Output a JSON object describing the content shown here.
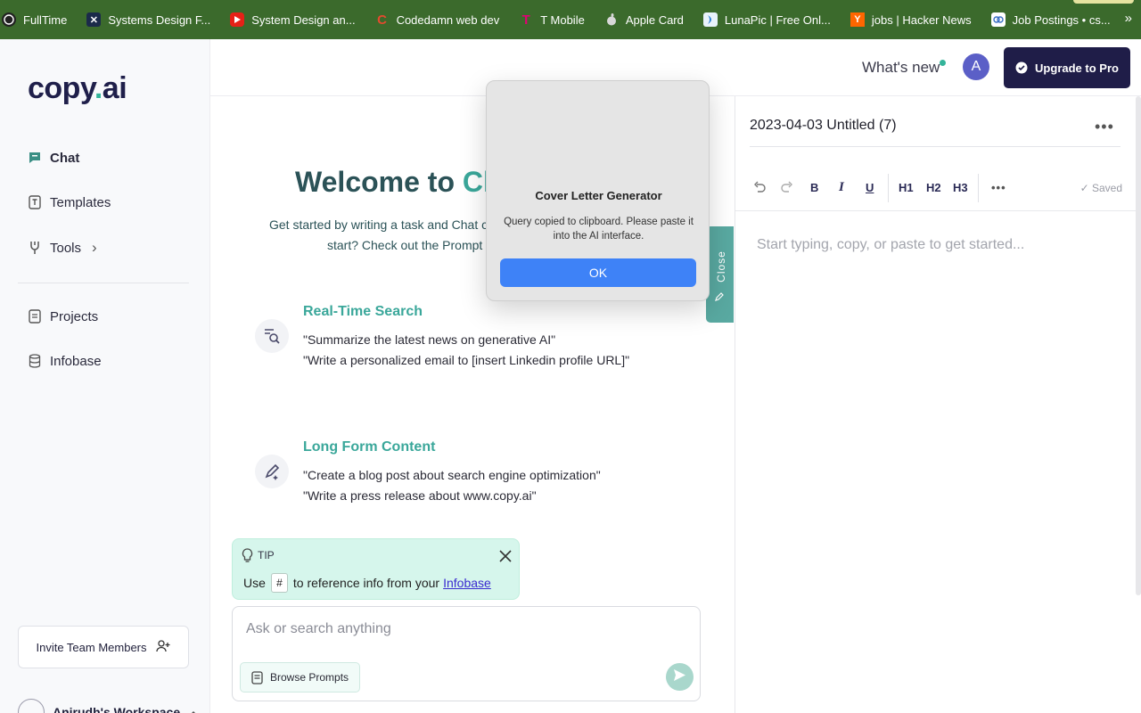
{
  "bookmarks": {
    "items": [
      {
        "label": "FullTime",
        "icon": "github-icon",
        "color": "#222222"
      },
      {
        "label": "Systems Design F...",
        "icon": "x-logo-icon",
        "color": "#1b2a4a"
      },
      {
        "label": "System Design an...",
        "icon": "youtube-icon",
        "color": "#e62117"
      },
      {
        "label": "Codedamn web dev",
        "icon": "codedamn-icon",
        "color": "#e34a2e"
      },
      {
        "label": "T Mobile",
        "icon": "tmobile-icon",
        "color": "#e20074"
      },
      {
        "label": "Apple Card",
        "icon": "apple-icon",
        "color": "#d8d8d8"
      },
      {
        "label": "LunaPic | Free Onl...",
        "icon": "lunapic-icon",
        "color": "#2a7fd4"
      },
      {
        "label": "jobs | Hacker News",
        "icon": "hackernews-icon",
        "color": "#ff6600"
      },
      {
        "label": "Job Postings • cs...",
        "icon": "job-postings-icon",
        "color": "#3a6fc4"
      }
    ],
    "more": "»"
  },
  "sidebar": {
    "logo_main": "copy",
    "logo_dot": ".",
    "logo_end": "ai",
    "nav": [
      {
        "label": "Chat",
        "icon": "chat-icon"
      },
      {
        "label": "Templates",
        "icon": "templates-icon"
      },
      {
        "label": "Tools",
        "icon": "tools-icon",
        "chevron": "›"
      },
      {
        "label": "Projects",
        "icon": "projects-icon"
      },
      {
        "label": "Infobase",
        "icon": "infobase-icon"
      }
    ],
    "invite_label": "Invite Team Members",
    "workspace_label": "Anirudh's Workspace",
    "workspace_avatar": "...."
  },
  "header": {
    "whats_new": "What's new",
    "avatar_letter": "A",
    "upgrade_label": "Upgrade to Pro"
  },
  "chat": {
    "welcome_prefix": "Welcome to ",
    "welcome_accent": "Cha",
    "intro_line1": "Get started by writing a task and Chat ca",
    "intro_line2": "start? Check out the Prompt l",
    "sections": [
      {
        "title": "Real-Time Search",
        "icon": "search-list-icon",
        "examples": [
          "\"Summarize the latest news on generative AI\"",
          "\"Write a personalized email to [insert Linkedin profile URL]\""
        ]
      },
      {
        "title": "Long Form Content",
        "icon": "pencil-sparkle-icon",
        "examples": [
          "\"Create a blog post about search engine optimization\"",
          "\"Write a press release about www.copy.ai\""
        ]
      }
    ],
    "tip": {
      "label": "TIP",
      "text_before": "Use",
      "key": "#",
      "text_after": "to reference info from your",
      "link": "Infobase"
    },
    "composer": {
      "placeholder": "Ask or search anything",
      "value": "",
      "browse_label": "Browse Prompts"
    },
    "close_tab_label": "Close"
  },
  "editor": {
    "title": "2023-04-03 Untitled (7)",
    "more": "•••",
    "toolbar": {
      "bold": "B",
      "italic": "I",
      "underline": "U",
      "h1": "H1",
      "h2": "H2",
      "h3": "H3",
      "more": "•••",
      "saved": "Saved"
    },
    "placeholder": "Start typing, copy, or paste to get started..."
  },
  "dialog": {
    "title": "Cover Letter Generator",
    "message": "Query copied to clipboard. Please paste it into the AI interface.",
    "ok_label": "OK"
  },
  "colors": {
    "accent_teal": "#3aa79a",
    "brand_navy": "#1f1d48",
    "bookmarks_bg": "#3b6a2c",
    "dialog_button": "#3e82f7"
  }
}
